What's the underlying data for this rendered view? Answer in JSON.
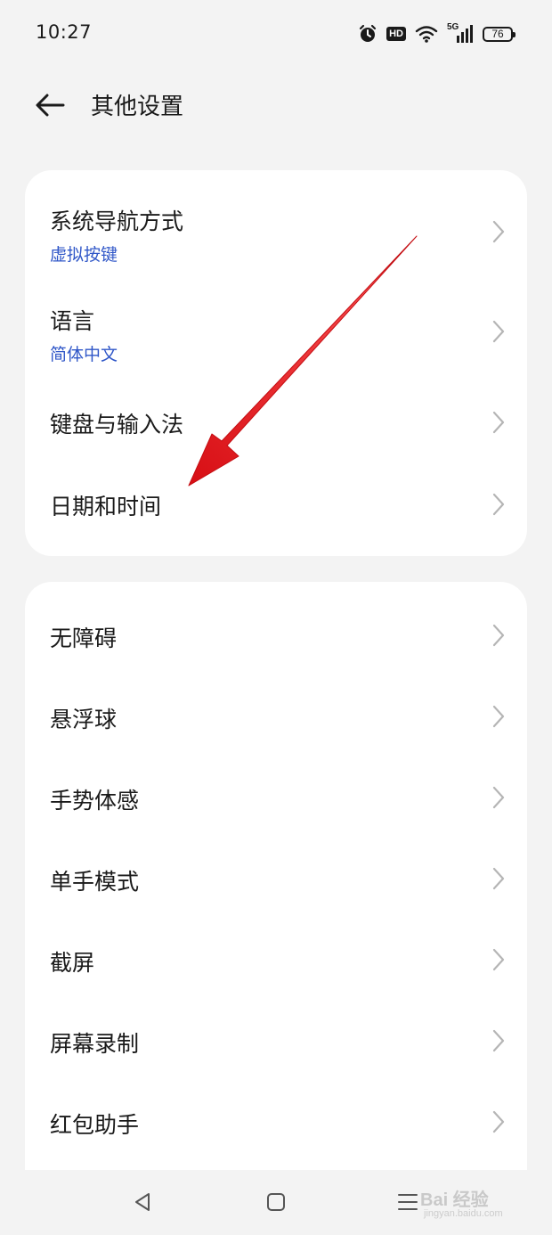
{
  "status_bar": {
    "time": "10:27",
    "network_label": "5G",
    "hd_label": "HD",
    "battery_level": "76",
    "icons": [
      "alarm-icon",
      "hd-icon",
      "wifi-icon",
      "cellular-signal-icon",
      "battery-icon"
    ]
  },
  "header": {
    "title": "其他设置",
    "back_icon": "arrow-left-icon"
  },
  "groups": [
    {
      "items": [
        {
          "title": "系统导航方式",
          "subtitle": "虚拟按键"
        },
        {
          "title": "语言",
          "subtitle": "简体中文"
        },
        {
          "title": "键盘与输入法",
          "subtitle": ""
        },
        {
          "title": "日期和时间",
          "subtitle": ""
        }
      ]
    },
    {
      "items": [
        {
          "title": "无障碍"
        },
        {
          "title": "悬浮球"
        },
        {
          "title": "手势体感"
        },
        {
          "title": "单手模式"
        },
        {
          "title": "截屏"
        },
        {
          "title": "屏幕录制"
        },
        {
          "title": "红包助手"
        }
      ]
    }
  ],
  "nav_bar": {
    "icons": [
      "back-triangle-icon",
      "home-square-icon",
      "menu-lines-icon"
    ]
  },
  "watermark": {
    "brand": "Bai 经验",
    "url": "jingyan.baidu.com"
  },
  "annotation": {
    "type": "red-arrow",
    "color": "#e8141c",
    "points_to": "日期和时间"
  },
  "colors": {
    "background": "#f3f3f3",
    "card": "#ffffff",
    "subtitle_accent": "#3057c8",
    "chevron": "#b5b5b5"
  }
}
